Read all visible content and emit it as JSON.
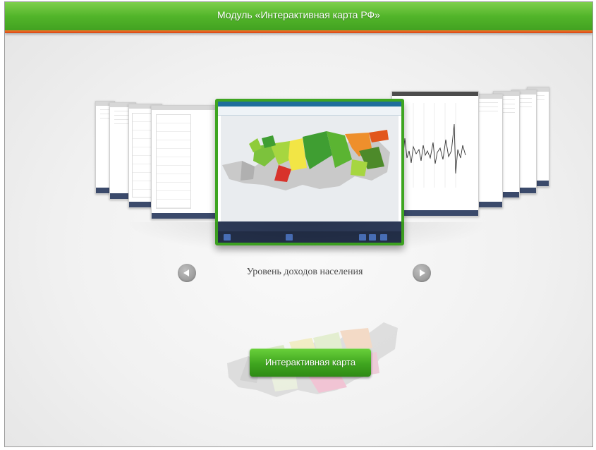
{
  "header": {
    "title": "Модуль «Интерактивная карта РФ»"
  },
  "carousel": {
    "current_caption": "Уровень доходов населения",
    "prev_icon": "chevron-left-icon",
    "next_icon": "chevron-right-icon"
  },
  "main_action": {
    "label": "Интерактивная карта"
  },
  "colors": {
    "header_green": "#52b52a",
    "header_accent": "#e05a1c",
    "button_green": "#3fa51f",
    "nav_gray": "#9a9a9a"
  }
}
